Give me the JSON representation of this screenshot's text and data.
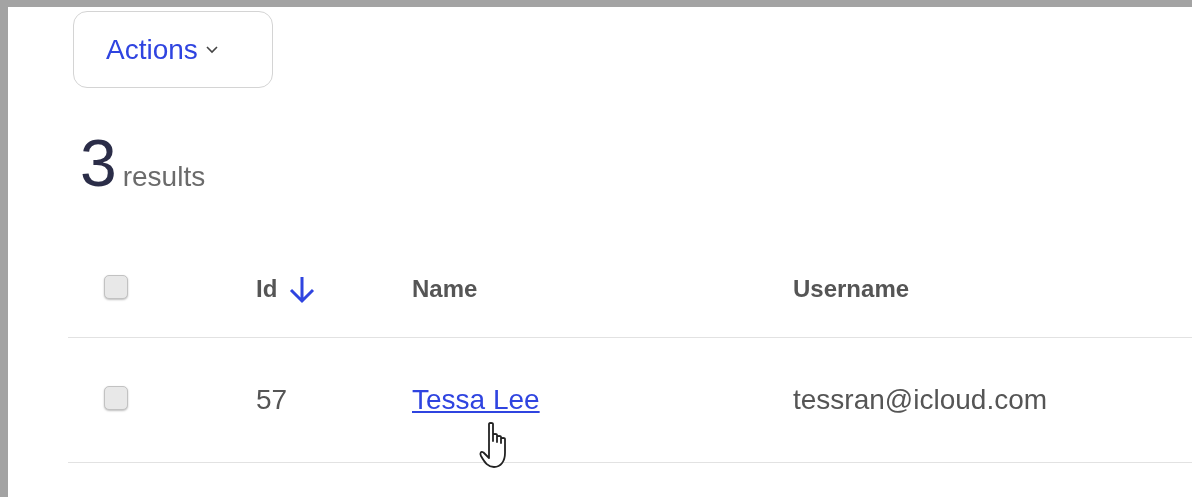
{
  "actions_button": {
    "label": "Actions"
  },
  "results": {
    "count": "3",
    "label": "results"
  },
  "table": {
    "select_all": {
      "checked": false
    },
    "columns": [
      {
        "label": "Id",
        "sorted": true
      },
      {
        "label": "Name",
        "sorted": false
      },
      {
        "label": "Username",
        "sorted": false
      }
    ],
    "rows": [
      {
        "checked": false,
        "id": "57",
        "name": "Tessa Lee",
        "username": "tessran@icloud.com"
      }
    ]
  }
}
